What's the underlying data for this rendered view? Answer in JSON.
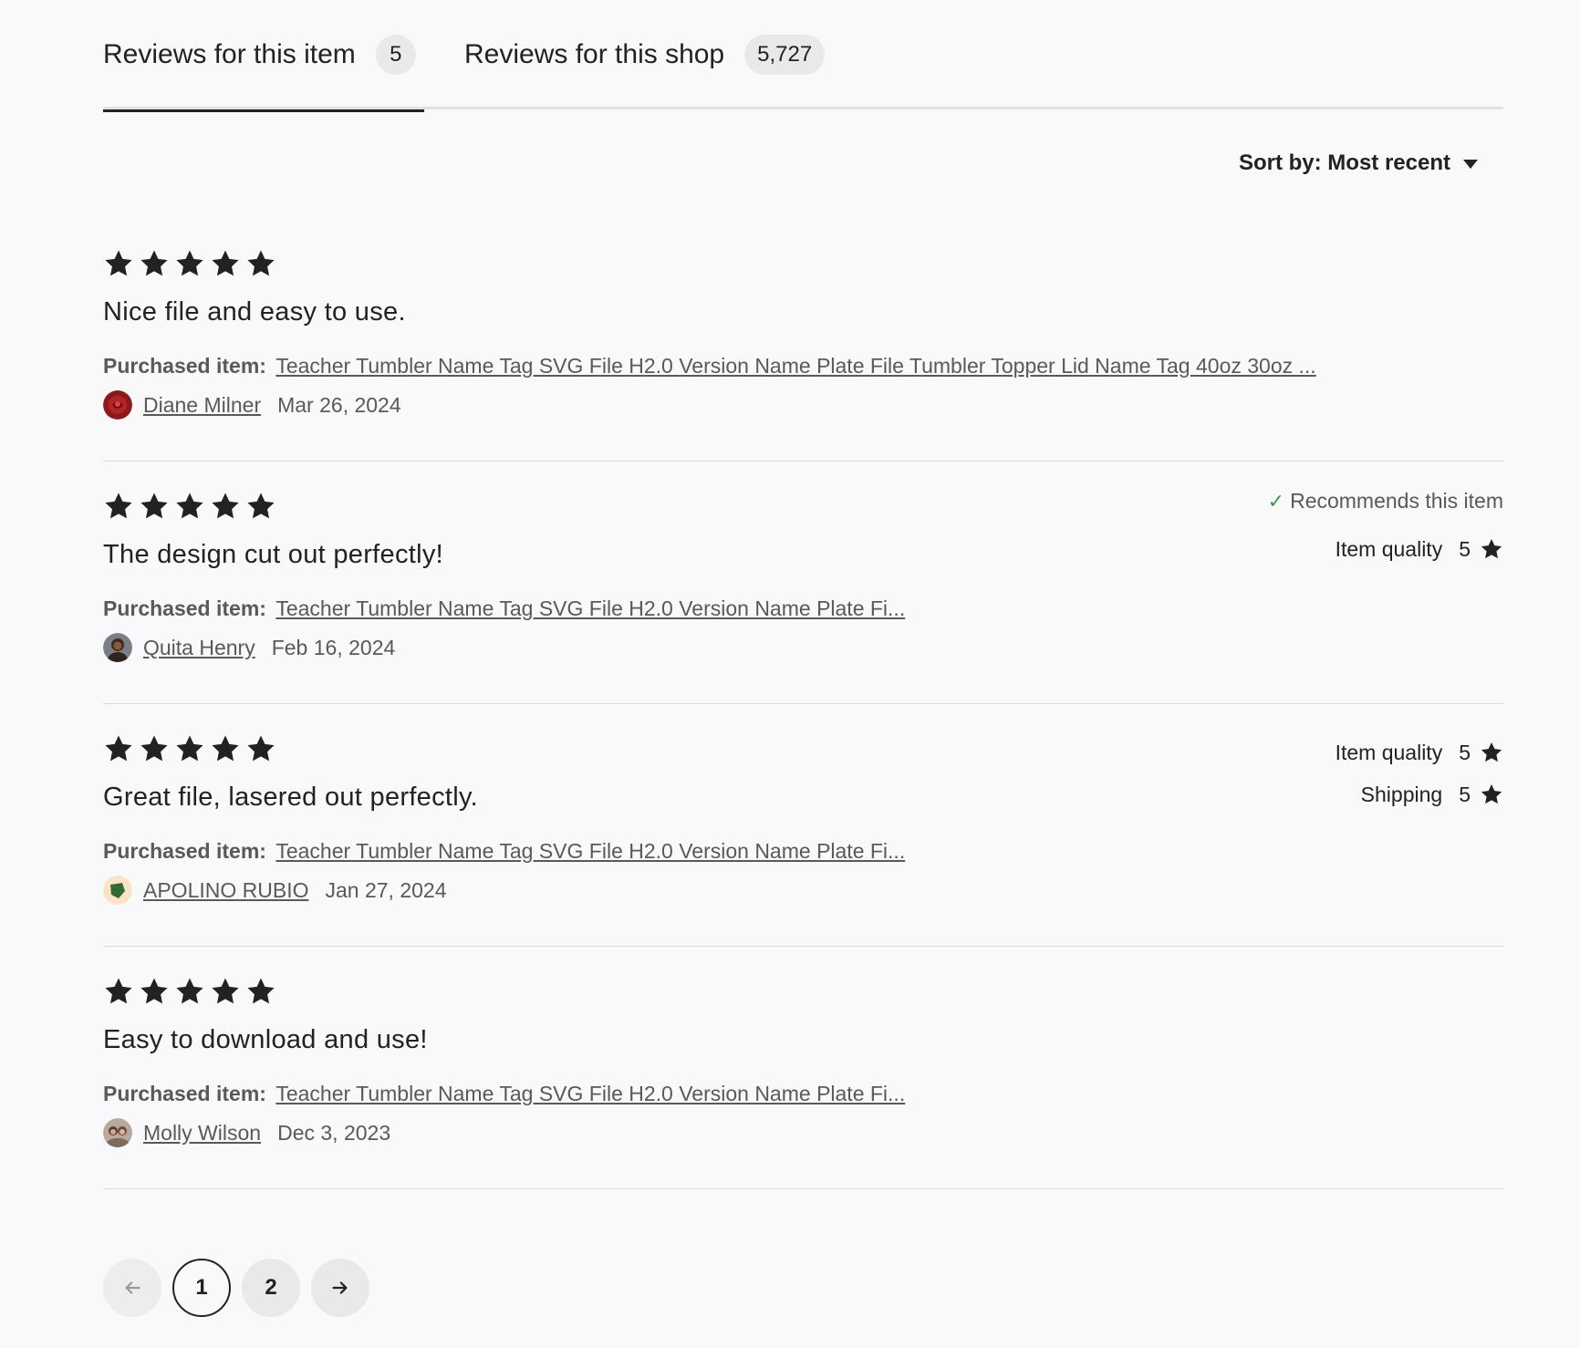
{
  "tabs": [
    {
      "label": "Reviews for this item",
      "count": "5"
    },
    {
      "label": "Reviews for this shop",
      "count": "5,727"
    }
  ],
  "sort": {
    "label": "Sort by: Most recent"
  },
  "purchased_label": "Purchased item:",
  "reviews": [
    {
      "rating": 5,
      "text": "Nice file and easy to use.",
      "item": "Teacher Tumbler Name Tag SVG File H2.0 Version Name Plate File Tumbler Topper Lid Name Tag 40oz 30oz ...",
      "author": "Diane Milner",
      "date": "Mar 26, 2024",
      "recommends": "",
      "metrics": []
    },
    {
      "rating": 5,
      "text": "The design cut out perfectly!",
      "item": "Teacher Tumbler Name Tag SVG File H2.0 Version Name Plate Fi...",
      "author": "Quita Henry",
      "date": "Feb 16, 2024",
      "recommends": "Recommends this item",
      "metrics": [
        {
          "label": "Item quality",
          "value": "5"
        }
      ]
    },
    {
      "rating": 5,
      "text": "Great file, lasered out perfectly.",
      "item": "Teacher Tumbler Name Tag SVG File H2.0 Version Name Plate Fi...",
      "author": "APOLINO RUBIO",
      "date": "Jan 27, 2024",
      "recommends": "",
      "metrics": [
        {
          "label": "Item quality",
          "value": "5"
        },
        {
          "label": "Shipping",
          "value": "5"
        }
      ]
    },
    {
      "rating": 5,
      "text": "Easy to download and use!",
      "item": "Teacher Tumbler Name Tag SVG File H2.0 Version Name Plate Fi...",
      "author": "Molly Wilson",
      "date": "Dec 3, 2023",
      "recommends": "",
      "metrics": []
    }
  ],
  "pagination": {
    "pages": [
      "1",
      "2"
    ],
    "current": "1",
    "prev_icon": "arrow-left-icon",
    "next_icon": "arrow-right-icon"
  },
  "colors": {
    "text": "#222222",
    "muted": "#595959",
    "check": "#3f9a4a",
    "background": "#f9f9fb"
  }
}
